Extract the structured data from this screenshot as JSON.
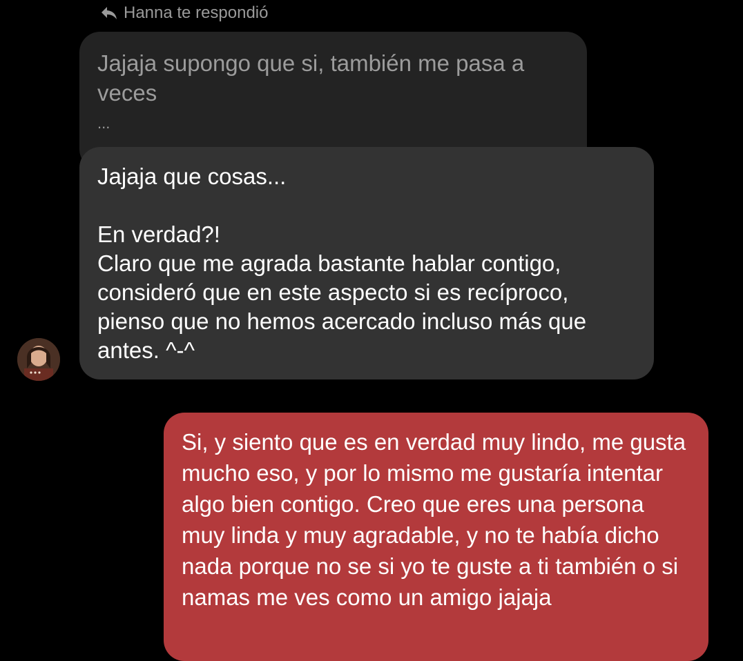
{
  "reply_header": {
    "icon": "reply-arrow-icon",
    "text": "Hanna te respondió"
  },
  "quoted_message": {
    "text": "Jajaja supongo que si, también me pasa a veces",
    "ellipsis": "..."
  },
  "received_message": {
    "line1": "Jajaja que cosas...",
    "line2": "En verdad?!",
    "line3": "Claro que me agrada bastante hablar contigo, consideró que en este aspecto si es recíproco, pienso que no hemos acercado incluso más que antes. ^-^"
  },
  "sent_message": {
    "text": "Si, y siento que es en verdad muy lindo, me gusta mucho eso, y por lo mismo me gustaría intentar algo bien contigo. Creo que eres una persona muy linda y muy agradable, y no te había dicho nada porque no se si yo te guste a ti también o si namas me ves como un amigo jajaja"
  },
  "colors": {
    "background": "#000000",
    "quoted_bubble": "#232323",
    "received_bubble": "#333333",
    "sent_bubble": "#b33a3c",
    "muted_text": "#9a9a9a"
  }
}
